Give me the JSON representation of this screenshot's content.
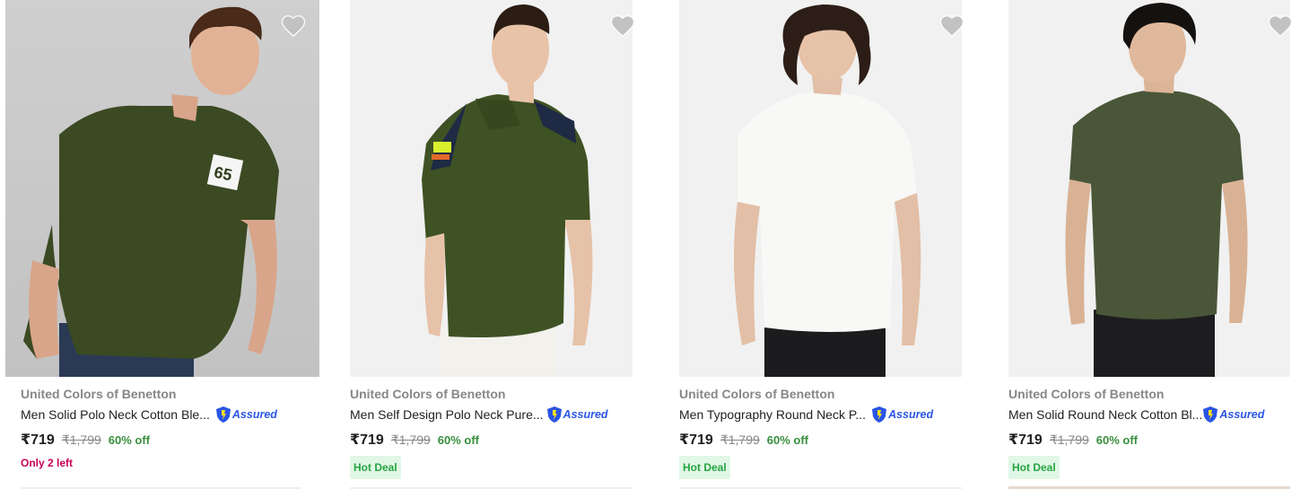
{
  "products": [
    {
      "brand": "United Colors of Benetton",
      "title": "Men Solid Polo Neck Cotton Ble...",
      "assured": "Assured",
      "price": "₹719",
      "mrp": "₹1,799",
      "discount": "60% off",
      "tag": "Only 2 left",
      "tag_type": "stock"
    },
    {
      "brand": "United Colors of Benetton",
      "title": "Men Self Design Polo Neck Pure...",
      "assured": "Assured",
      "price": "₹719",
      "mrp": "₹1,799",
      "discount": "60% off",
      "tag": "Hot Deal",
      "tag_type": "deal"
    },
    {
      "brand": "United Colors of Benetton",
      "title": "Men Typography Round Neck P...",
      "assured": "Assured",
      "price": "₹719",
      "mrp": "₹1,799",
      "discount": "60% off",
      "tag": "Hot Deal",
      "tag_type": "deal"
    },
    {
      "brand": "United Colors of Benetton",
      "title": "Men Solid Round Neck Cotton Bl...",
      "assured": "Assured",
      "price": "₹719",
      "mrp": "₹1,799",
      "discount": "60% off",
      "tag": "Hot Deal",
      "tag_type": "deal"
    }
  ],
  "colors": {
    "accent_assured": "#2a55e5",
    "discount": "#388e3c",
    "stock": "#c70055",
    "deal_bg": "#e1f7e6"
  }
}
